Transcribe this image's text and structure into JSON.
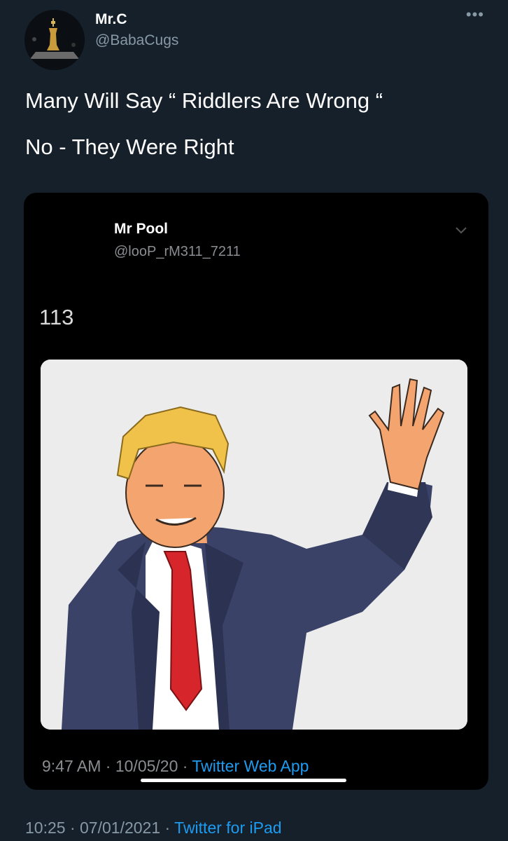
{
  "tweet": {
    "display_name": "Mr.C",
    "username": "@BabaCugs",
    "text_line1": "Many Will Say “ Riddlers Are Wrong “",
    "text_line2": "No - They Were Right",
    "more_icon": "more-horizontal-icon",
    "footer": {
      "time": "10:25",
      "separator": " · ",
      "date": "07/01/2021",
      "source": "Twitter for iPad"
    }
  },
  "embedded_screenshot": {
    "display_name": "Mr Pool",
    "username": "@looP_rM311_7211",
    "count": "113",
    "chevron_icon": "chevron-down-icon",
    "footer": {
      "time": "9:47 AM",
      "separator": " · ",
      "date": "10/05/20",
      "source": "Twitter Web App"
    }
  },
  "colors": {
    "background": "#15202b",
    "embed_background": "#000000",
    "secondary_text": "#8899a6",
    "link": "#1d9bf0",
    "tie_red": "#d7262b",
    "suit_blue": "#3a4268",
    "hair_yellow": "#f0c24a",
    "skin": "#f4a46e"
  }
}
